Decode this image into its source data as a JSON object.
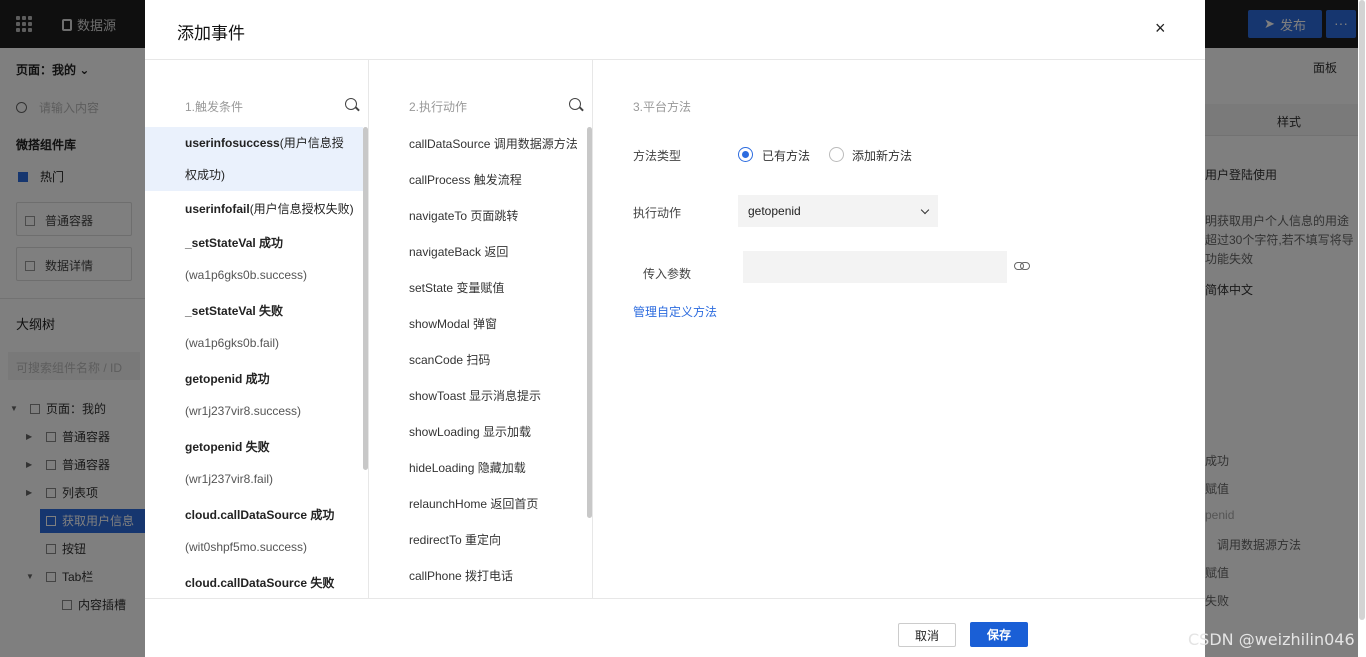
{
  "background": {
    "topbar": {
      "datasource_tab": "数据源",
      "publish_label": "发布",
      "more_label": "···"
    },
    "left_panel": {
      "page_selector": "页面：我的",
      "search_placeholder": "请输入内容",
      "component_lib": "微搭组件库",
      "hot_label": "热门",
      "cards": [
        "普通容器",
        "数据详情"
      ],
      "outline_title": "大纲树",
      "outline_filter": "可搜索组件名称 / ID",
      "tree": [
        {
          "label": "页面：我的",
          "depth": 0
        },
        {
          "label": "普通容器",
          "depth": 1
        },
        {
          "label": "普通容器",
          "depth": 1
        },
        {
          "label": "列表项",
          "depth": 1
        },
        {
          "label": "获取用户信息",
          "depth": 1,
          "selected": true
        },
        {
          "label": "按钮",
          "depth": 1
        },
        {
          "label": "Tab栏",
          "depth": 1
        },
        {
          "label": "内容插槽",
          "depth": 2
        }
      ]
    },
    "right_panel": {
      "panel_label": "面板",
      "style_tab": "样式",
      "desc_value": "用户登陆使用",
      "desc_hint_1": "明获取用户个人信息的用途",
      "desc_hint_2": "超过30个字符,若不填写将导",
      "desc_hint_3": "功能失效",
      "lang_value": "简体中文",
      "events": [
        "成功",
        "赋值",
        "penid",
        "调用数据源方法",
        "赋值",
        "失败"
      ]
    }
  },
  "dialog": {
    "title": "添加事件",
    "close_label": "×",
    "col1": {
      "header": "1.触发条件",
      "items": [
        {
          "name": "userinfosuccess",
          "tail": "(用户信息授",
          "line2": "权成功)",
          "active": true
        },
        {
          "name": "userinfofail",
          "tail": "(用户信息授权失败)",
          "line2": ""
        },
        {
          "name": "_setStateVal 成功",
          "tail": "",
          "line2": "(wa1p6gks0b.success)"
        },
        {
          "name": "_setStateVal 失败",
          "tail": "",
          "line2": "(wa1p6gks0b.fail)"
        },
        {
          "name": "getopenid 成功",
          "tail": "",
          "line2": "(wr1j237vir8.success)"
        },
        {
          "name": "getopenid 失败",
          "tail": "",
          "line2": "(wr1j237vir8.fail)"
        },
        {
          "name": "cloud.callDataSource 成功",
          "tail": "",
          "line2": "(wit0shpf5mo.success)"
        },
        {
          "name": "cloud.callDataSource 失败",
          "tail": "",
          "line2": ""
        }
      ]
    },
    "col2": {
      "header": "2.执行动作",
      "items": [
        "callDataSource 调用数据源方法",
        "callProcess 触发流程",
        "navigateTo 页面跳转",
        "navigateBack 返回",
        "setState 变量赋值",
        "showModal 弹窗",
        "scanCode 扫码",
        "showToast 显示消息提示",
        "showLoading 显示加载",
        "hideLoading 隐藏加载",
        "relaunchHome 返回首页",
        "redirectTo 重定向",
        "callPhone 拨打电话"
      ]
    },
    "col3": {
      "header": "3.平台方法",
      "method_type_label": "方法类型",
      "radio_existing": "已有方法",
      "radio_new": "添加新方法",
      "action_label": "执行动作",
      "action_value": "getopenid",
      "param_label": "传入参数",
      "param_value": "",
      "manage_link": "管理自定义方法"
    },
    "footer": {
      "cancel": "取消",
      "save": "保存"
    }
  },
  "watermark": "CSDN @weizhilin046",
  "colors": {
    "accent": "#2d6cdf",
    "save_button": "#1a5fd6",
    "active_row": "#eaf1fc"
  }
}
